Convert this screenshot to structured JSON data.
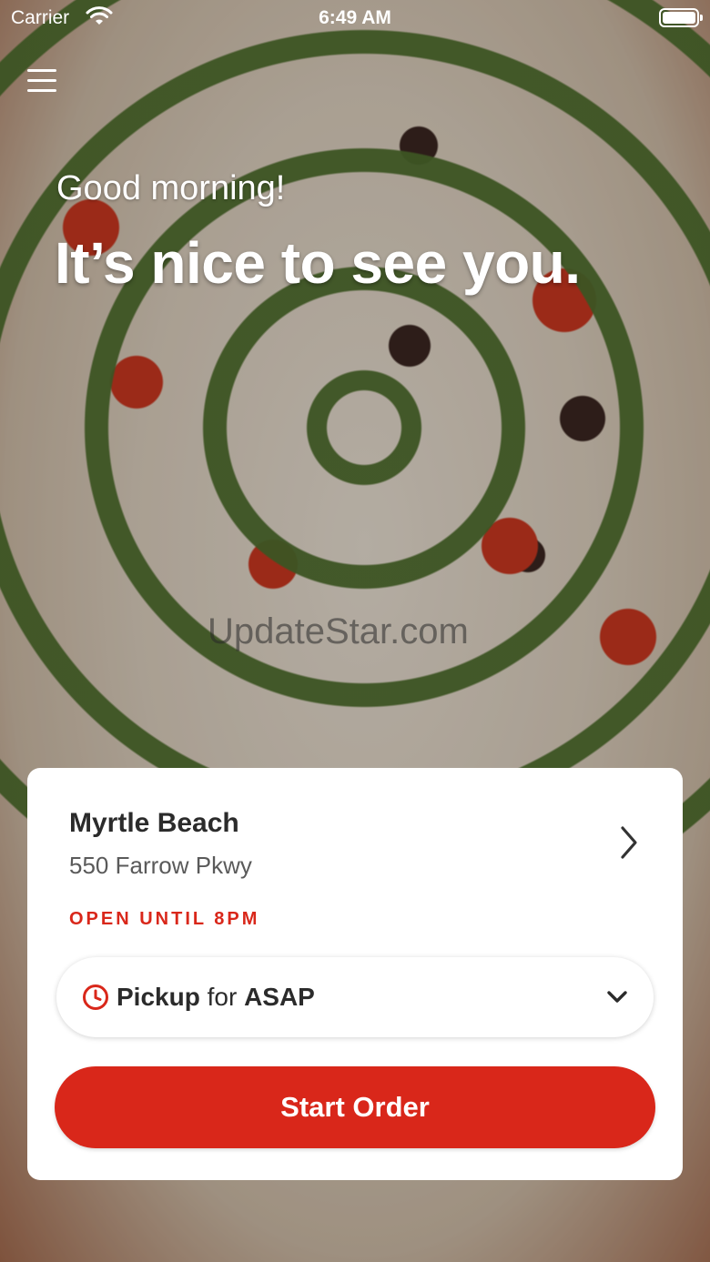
{
  "status_bar": {
    "carrier": "Carrier",
    "time": "6:49 AM",
    "icons": [
      "wifi-icon",
      "battery-icon"
    ]
  },
  "header": {
    "menu_icon": "hamburger-menu-icon"
  },
  "hero": {
    "greeting": "Good morning!",
    "headline": "It’s nice to see you.",
    "watermark": "UpdateStar.com"
  },
  "store_card": {
    "store_name": "Myrtle Beach",
    "address": "550 Farrow Pkwy",
    "open_status": "OPEN UNTIL 8PM",
    "order_mode": "Pickup",
    "order_mode_connector": "for",
    "order_time": "ASAP",
    "start_order_label": "Start Order"
  },
  "colors": {
    "accent": "#d9271a",
    "card_background": "#ffffff",
    "primary_text": "#2b2b2b",
    "secondary_text": "#5a5a5a"
  }
}
